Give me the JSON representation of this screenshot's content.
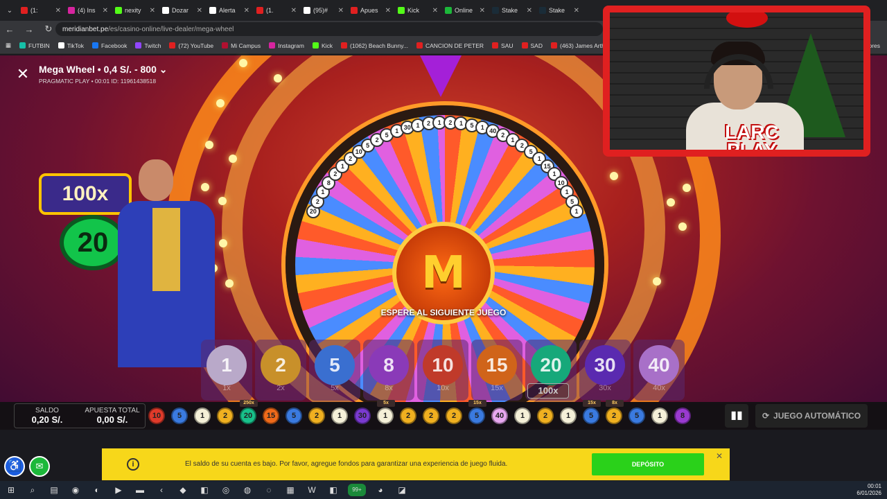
{
  "browser": {
    "tabs": [
      {
        "label": "(1:",
        "color": "#e02020"
      },
      {
        "label": "(4) Ins",
        "color": "#d6249f"
      },
      {
        "label": "nexity",
        "color": "#53fc18"
      },
      {
        "label": "Dozar",
        "color": "#ffffff"
      },
      {
        "label": "Alerta",
        "color": "#ffffff"
      },
      {
        "label": "(1.",
        "color": "#e02020"
      },
      {
        "label": "(95)#",
        "color": "#ffffff"
      },
      {
        "label": "Apues",
        "color": "#e02020"
      },
      {
        "label": "Kick",
        "color": "#53fc18"
      },
      {
        "label": "Online",
        "color": "#1cb83a"
      },
      {
        "label": "Stake",
        "color": "#1a2c38"
      },
      {
        "label": "Stake",
        "color": "#1a2c38"
      }
    ],
    "url_host": "meridianbet.pe",
    "url_path": "/es/casino-online/live-dealer/mega-wheel",
    "bookmarks": [
      {
        "label": "FUTBIN",
        "color": "#16c0a8"
      },
      {
        "label": "TikTok",
        "color": "#ffffff"
      },
      {
        "label": "Facebook",
        "color": "#1877f2"
      },
      {
        "label": "Twitch",
        "color": "#9146ff"
      },
      {
        "label": "(72) YouTube",
        "color": "#e02020"
      },
      {
        "label": "Mi Campus",
        "color": "#b01030"
      },
      {
        "label": "Instagram",
        "color": "#d6249f"
      },
      {
        "label": "Kick",
        "color": "#53fc18"
      },
      {
        "label": "(1062) Beach Bunny...",
        "color": "#e02020"
      },
      {
        "label": "CANCION DE PETER",
        "color": "#e02020"
      },
      {
        "label": "SAU",
        "color": "#e02020"
      },
      {
        "label": "SAD",
        "color": "#e02020"
      },
      {
        "label": "(463) James Arthur -...",
        "color": "#e02020"
      }
    ],
    "bookmarks_overflow": "dores"
  },
  "game": {
    "title": "Mega Wheel • 0,4 S/. - 800",
    "provider": "PRAGMATIC PLAY • 00:01 ID: 11961438518",
    "status": "ESPERE AL SIGUIENTE JUEGO",
    "hub_letter": "M",
    "sign_multiplier": "100x",
    "sign_number": "20",
    "bets": [
      {
        "number": "1",
        "mult": "1x",
        "color": "#b9a9c9"
      },
      {
        "number": "2",
        "mult": "2x",
        "color": "#c8902a"
      },
      {
        "number": "5",
        "mult": "5x",
        "color": "#3a6fd0"
      },
      {
        "number": "8",
        "mult": "8x",
        "color": "#8a3ab8"
      },
      {
        "number": "10",
        "mult": "10x",
        "color": "#c03a2a"
      },
      {
        "number": "15",
        "mult": "15x",
        "color": "#d0641a"
      },
      {
        "number": "20",
        "mult": "",
        "color": "#16a87a"
      },
      {
        "number": "30",
        "mult": "30x",
        "color": "#5a2ab0"
      },
      {
        "number": "40",
        "mult": "40x",
        "color": "#a870c8"
      }
    ],
    "boosted_multiplier": "100x",
    "wheel_numbers": [
      "20",
      "2",
      "1",
      "8",
      "2",
      "1",
      "2",
      "10",
      "5",
      "2",
      "5",
      "1",
      "30",
      "1",
      "2",
      "1",
      "2",
      "1",
      "5",
      "1",
      "40",
      "2",
      "1",
      "2",
      "5",
      "1",
      "15",
      "1",
      "10",
      "1",
      "5",
      "1"
    ],
    "saldo_label": "SALDO",
    "saldo_value": "0,20 S/.",
    "apuesta_label": "APUESTA TOTAL",
    "apuesta_value": "0,00 S/.",
    "auto_label": "JUEGO AUTOMÁTICO",
    "history": [
      {
        "v": "10",
        "color": "#e03a2a",
        "tag": ""
      },
      {
        "v": "5",
        "color": "#3a7ae0",
        "tag": ""
      },
      {
        "v": "1",
        "color": "#f5f0d8",
        "tag": ""
      },
      {
        "v": "2",
        "color": "#f0b020",
        "tag": ""
      },
      {
        "v": "20",
        "color": "#18c08a",
        "tag": "250x"
      },
      {
        "v": "15",
        "color": "#f06a1a",
        "tag": ""
      },
      {
        "v": "5",
        "color": "#3a7ae0",
        "tag": ""
      },
      {
        "v": "2",
        "color": "#f0b020",
        "tag": ""
      },
      {
        "v": "1",
        "color": "#f5f0d8",
        "tag": ""
      },
      {
        "v": "30",
        "color": "#7a3ad0",
        "tag": ""
      },
      {
        "v": "1",
        "color": "#f5f0d8",
        "tag": "5x"
      },
      {
        "v": "2",
        "color": "#f0b020",
        "tag": ""
      },
      {
        "v": "2",
        "color": "#f0b020",
        "tag": ""
      },
      {
        "v": "2",
        "color": "#f0b020",
        "tag": ""
      },
      {
        "v": "5",
        "color": "#3a7ae0",
        "tag": "15x"
      },
      {
        "v": "40",
        "color": "#e8a8f0",
        "tag": ""
      },
      {
        "v": "1",
        "color": "#f5f0d8",
        "tag": ""
      },
      {
        "v": "2",
        "color": "#f0b020",
        "tag": ""
      },
      {
        "v": "1",
        "color": "#f5f0d8",
        "tag": ""
      },
      {
        "v": "5",
        "color": "#3a7ae0",
        "tag": "15x"
      },
      {
        "v": "2",
        "color": "#f0b020",
        "tag": "8x"
      },
      {
        "v": "5",
        "color": "#3a7ae0",
        "tag": ""
      },
      {
        "v": "1",
        "color": "#f5f0d8",
        "tag": ""
      },
      {
        "v": "8",
        "color": "#9a3ad0",
        "tag": ""
      }
    ]
  },
  "overlay": {
    "logo_line1": "LARC",
    "logo_line2": "PLAY"
  },
  "notice": {
    "message": "El saldo de su cuenta es bajo. Por favor, agregue fondos para garantizar una experiencia de juego fluida.",
    "button": "DEPÓSITO"
  },
  "taskbar": {
    "time": "00:01",
    "date": "6/01/2026",
    "badge": "99+"
  }
}
